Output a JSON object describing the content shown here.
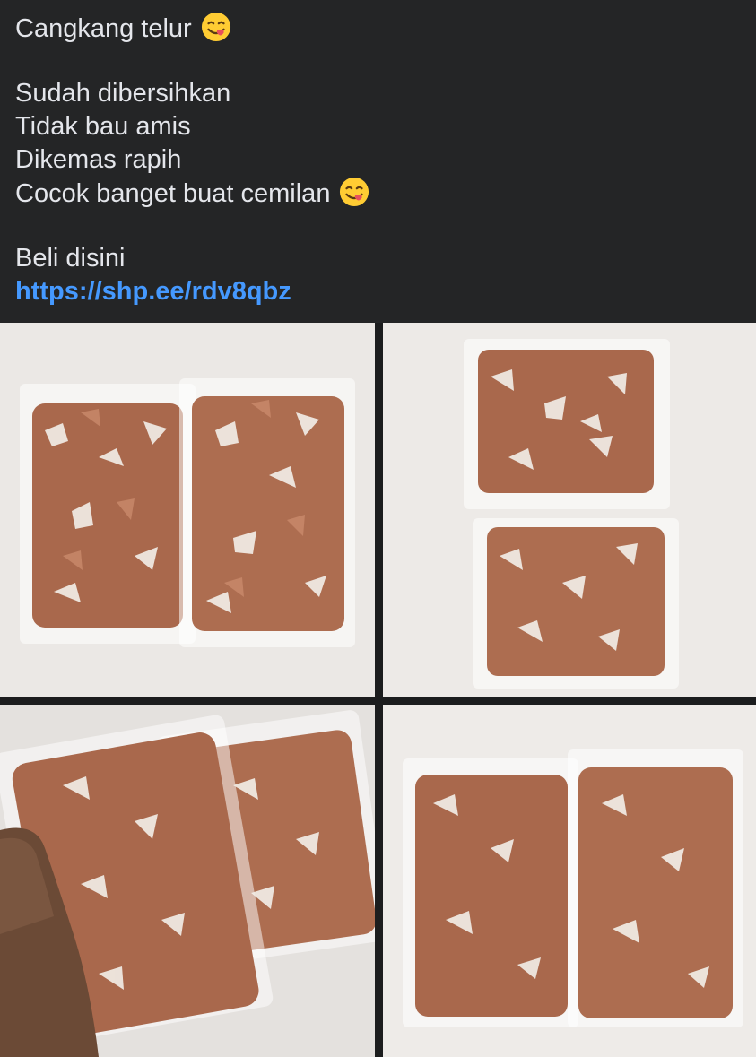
{
  "post": {
    "lines": [
      "Cangkang telur",
      "Sudah dibersihkan",
      "Tidak bau amis",
      "Dikemas rapih",
      "Cocok banget buat cemilan",
      "Beli disini"
    ],
    "link": "https://shp.ee/rdv8qbz",
    "emoji_icon": "savoring-food-face-emoji"
  },
  "photos": [
    {
      "name": "two-bags-of-eggshells-photo"
    },
    {
      "name": "two-stacked-bags-of-eggshells-photo"
    },
    {
      "name": "hand-holding-bags-of-eggshells-photo"
    },
    {
      "name": "two-bags-of-eggshells-photo-2"
    }
  ],
  "colors": {
    "background": "#242526",
    "text": "#e4e6eb",
    "link": "#4599ff",
    "shell": "#b8775a"
  }
}
